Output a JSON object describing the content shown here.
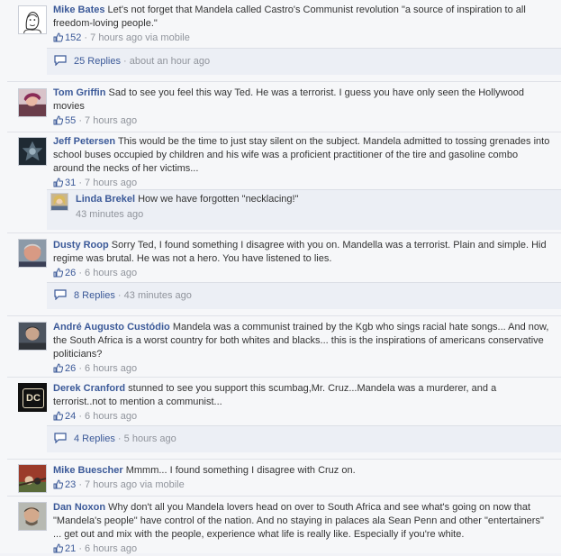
{
  "comments": [
    {
      "author": "Mike Bates",
      "text": "Let's not forget that Mandela called Castro's Communist revolution \"a source of inspiration to all freedom-loving people.\"",
      "likes": "152",
      "time": "7 hours ago via mobile",
      "replies": "25 Replies",
      "replies_time": "about an hour ago"
    },
    {
      "author": "Tom Griffin",
      "text": "Sad to see you feel this way Ted. He was a terrorist. I guess you have only seen the Hollywood movies",
      "likes": "55",
      "time": "7 hours ago"
    },
    {
      "author": "Jeff Petersen",
      "text": "This would be the time to just stay silent on the subject. Mandela admitted to tossing grenades into school buses occupied by children and his wife was a proficient practitioner of the tire and gasoline combo around the necks of her victims...",
      "likes": "31",
      "time": "7 hours ago",
      "reply": {
        "author": "Linda Brekel",
        "text": "How we have forgotten \"necklacing!\"",
        "time": "43 minutes ago"
      }
    },
    {
      "author": "Dusty Roop",
      "text": "Sorry Ted, I found something I disagree with you on. Mandella was a terrorist. Plain and simple. Hid regime was brutal. He was not a hero. You have listened to lies.",
      "likes": "26",
      "time": "6 hours ago",
      "replies": "8 Replies",
      "replies_time": "43 minutes ago"
    },
    {
      "author": "André Augusto Custódio",
      "text": "Mandela was a communist trained by the Kgb who sings racial hate songs... And now, the South Africa is a worst country for both whites and blacks... this is the inspirations of americans conservative politicians?",
      "likes": "26",
      "time": "6 hours ago"
    },
    {
      "author": "Derek Cranford",
      "text": "stunned to see you support this scumbag,Mr. Cruz...Mandela was a murderer, and a terrorist..not to mention a communist...",
      "likes": "24",
      "time": "6 hours ago",
      "replies": "4 Replies",
      "replies_time": "5 hours ago",
      "avatar_text": "DC"
    },
    {
      "author": "Mike Buescher",
      "text": "Mmmm... I found something I disagree with Cruz on.",
      "likes": "23",
      "time": "7 hours ago via mobile"
    },
    {
      "author": "Dan Noxon",
      "text": "Why don't all you Mandela lovers head on over to South Africa and see what's going on now that \"Mandela's people\" have control of the nation. And no staying in palaces ala Sean Penn and other \"entertainers\" ... get out and mix with the people, experience what life is really like. Especially if you're white.",
      "likes": "21",
      "time": "6 hours ago"
    }
  ],
  "dot": "·",
  "colors": {
    "link": "#3b5998",
    "meta": "#90949c",
    "replybar": "#eceff5"
  }
}
